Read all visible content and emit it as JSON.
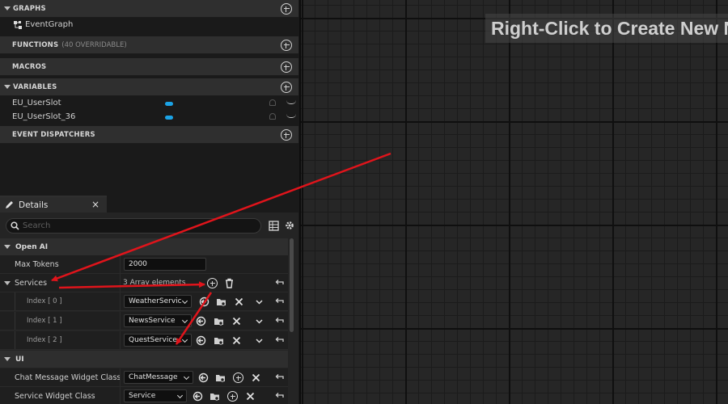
{
  "my_blueprint": {
    "graphs": {
      "title": "GRAPHS",
      "items": [
        "EventGraph"
      ]
    },
    "functions": {
      "title": "FUNCTIONS",
      "sub": "(40 OVERRIDABLE)"
    },
    "macros": {
      "title": "MACROS"
    },
    "variables": {
      "title": "VARIABLES",
      "items": [
        "EU_UserSlot",
        "EU_UserSlot_36"
      ]
    },
    "event_dispatchers": {
      "title": "EVENT DISPATCHERS"
    }
  },
  "details": {
    "tab_label": "Details",
    "close_glyph": "×",
    "search_placeholder": "Search",
    "categories": {
      "open_ai": "Open AI",
      "ui": "UI"
    },
    "max_tokens": {
      "label": "Max Tokens",
      "value": "2000"
    },
    "services": {
      "label": "Services",
      "summary": "3 Array elements"
    },
    "indexes": [
      {
        "label": "Index [ 0 ]",
        "value": "WeatherServic"
      },
      {
        "label": "Index [ 1 ]",
        "value": "NewsService"
      },
      {
        "label": "Index [ 2 ]",
        "value": "QuestService"
      }
    ],
    "ui_props": [
      {
        "label": "Chat Message Widget Class",
        "value": "ChatMessage"
      },
      {
        "label": "Service Widget Class",
        "value": "Service"
      }
    ]
  },
  "graph": {
    "hint": "Right-Click to Create New N"
  },
  "colors": {
    "annotation_arrow": "#e0141b",
    "variable_pill": "#1ba3e6"
  }
}
